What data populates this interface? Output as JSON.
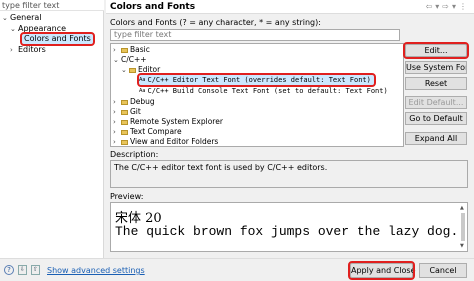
{
  "left": {
    "filter_placeholder": "type filter text",
    "tree": [
      {
        "label": "General",
        "twisty": "⌄"
      },
      {
        "label": "Appearance",
        "twisty": "⌄"
      },
      {
        "label": "Colors and Fonts",
        "twisty": ""
      },
      {
        "label": "Editors",
        "twisty": "›"
      }
    ]
  },
  "right": {
    "title": "Colors and Fonts",
    "subtitle": "Colors and Fonts (? = any character, * = any string):",
    "filter_placeholder": "type filter text",
    "tree": [
      {
        "label": "Basic",
        "twisty": "›"
      },
      {
        "label": "C/C++",
        "twisty": "⌄"
      },
      {
        "label": "Editor",
        "twisty": "⌄"
      },
      {
        "label": "C/C++ Editor Text Font (overrides default: Text Font)",
        "icon": "Aa"
      },
      {
        "label": "C/C++ Build Console Text Font (set to default: Text Font)",
        "icon": "Aa"
      },
      {
        "label": "Debug",
        "twisty": "›"
      },
      {
        "label": "Git",
        "twisty": "›"
      },
      {
        "label": "Remote System Explorer",
        "twisty": "›"
      },
      {
        "label": "Text Compare",
        "twisty": "›"
      },
      {
        "label": "View and Editor Folders",
        "twisty": "›"
      }
    ],
    "buttons": {
      "edit": "Edit...",
      "use_system_font": "Use System Font",
      "reset": "Reset",
      "edit_default": "Edit Default...",
      "go_to_default": "Go to Default",
      "expand_all": "Expand All"
    },
    "description_label": "Description:",
    "description_text": "The C/C++ editor text font is used by C/C++ editors.",
    "preview_label": "Preview:",
    "preview_line1": "宋体 20",
    "preview_line2": "The quick brown fox jumps over the lazy dog."
  },
  "bottom": {
    "show_advanced": "Show advanced settings",
    "apply_close": "Apply and Close",
    "cancel": "Cancel"
  },
  "colors": {
    "highlight": "#e0201f",
    "selection": "#cce8ff",
    "link": "#1a5fb4"
  }
}
